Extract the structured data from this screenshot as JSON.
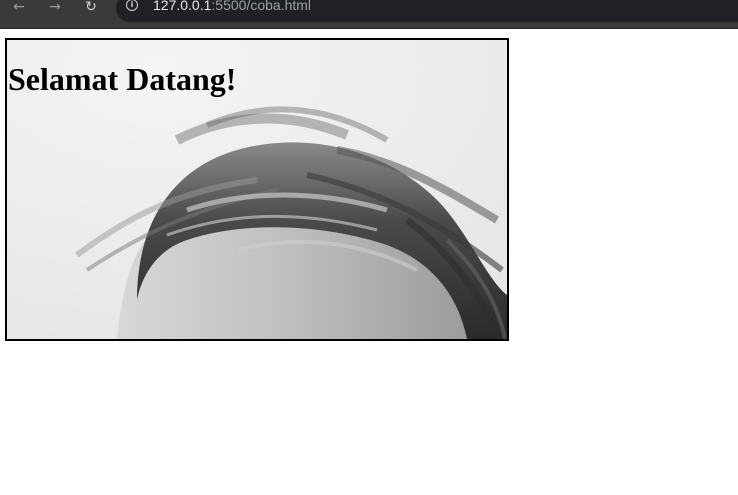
{
  "browser": {
    "url_host": "127.0.0.1",
    "url_path": ":5500/coba.html",
    "back_glyph": "←",
    "forward_glyph": "→",
    "reload_glyph": "↻",
    "info_glyph": "i"
  },
  "page": {
    "heading": "Selamat Datang!"
  },
  "icons": [
    "back-arrow-icon",
    "forward-arrow-icon",
    "reload-icon",
    "info-icon"
  ],
  "colors": {
    "toolbar": "#3a3a3a",
    "address_bar": "#202124",
    "hero_border": "#000000"
  }
}
